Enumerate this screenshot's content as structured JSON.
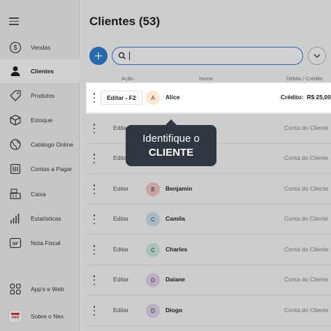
{
  "sidebar": {
    "items": [
      {
        "label": "Vendas",
        "icon": "dollar-icon"
      },
      {
        "label": "Clientes",
        "icon": "person-icon",
        "active": true
      },
      {
        "label": "Produtos",
        "icon": "tag-icon"
      },
      {
        "label": "Estoque",
        "icon": "box-icon"
      },
      {
        "label": "Catálogo Online",
        "icon": "globe-icon"
      },
      {
        "label": "Contas a Pagar",
        "icon": "bills-icon"
      },
      {
        "label": "Caixa",
        "icon": "cash-register-icon"
      },
      {
        "label": "Estatísticas",
        "icon": "bar-chart-icon"
      },
      {
        "label": "Nota Fiscal",
        "icon": "nf-icon"
      }
    ],
    "apps_label": "App's e Web",
    "about_label": "Sobre o Nex",
    "nf_badge": "NF",
    "logo_text": "nex"
  },
  "main": {
    "title": "Clientes (53)",
    "search": {
      "value": "",
      "placeholder": ""
    },
    "columns": {
      "action": "Ação",
      "name": "Nome",
      "debt": "Débito / Crédito"
    },
    "highlighted_row": {
      "edit": "Editar - F2",
      "initial": "A",
      "name": "Alice",
      "credit_label": "Crédito:",
      "credit_value": "R$ 25,00"
    },
    "rows": [
      {
        "edit": "Editar",
        "initial": "",
        "name": "",
        "debt": "Conta do Cliente"
      },
      {
        "edit": "Editar",
        "initial": "",
        "name": "",
        "debt": "Conta do Cliente"
      },
      {
        "edit": "Editar",
        "initial": "B",
        "name": "Benjamin",
        "debt": "Conta do Cliente"
      },
      {
        "edit": "Editar",
        "initial": "C",
        "name": "Camila",
        "debt": "Conta do Cliente"
      },
      {
        "edit": "Editar",
        "initial": "C",
        "name": "Charles",
        "debt": "Conta do Cliente"
      },
      {
        "edit": "Editar",
        "initial": "D",
        "name": "Daiane",
        "debt": "Conta do Cliente"
      },
      {
        "edit": "Editar",
        "initial": "D",
        "name": "Diogo",
        "debt": "Conta do Cliente"
      }
    ]
  },
  "tooltip": {
    "line1": "Identifique o",
    "line2": "CLIENTE"
  },
  "colors": {
    "accent": "#2f80d4",
    "tooltip_bg": "#2e3640",
    "avatar_a": "#fde7cf",
    "avatar_b": "#f6c9c9",
    "avatar_c": "#cfe3f2",
    "avatar_c2": "#cdeee7",
    "avatar_d": "#e3d6ef"
  }
}
